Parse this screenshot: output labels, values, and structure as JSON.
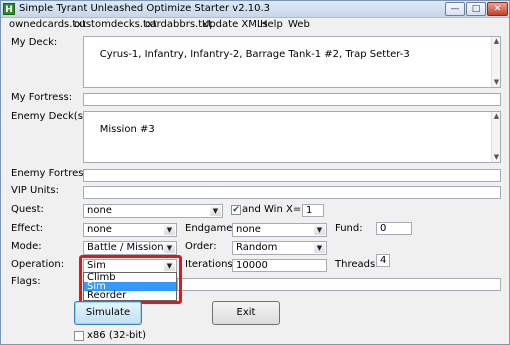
{
  "window": {
    "title": "Simple Tyrant Unleashed Optimize Starter v2.10.3",
    "icon": "H"
  },
  "menu": [
    "ownedcards.txt",
    "customdecks.txt",
    "cardabbrs.txt",
    "Update XMLs",
    "Help",
    "Web"
  ],
  "fields": {
    "my_deck": {
      "label": "My Deck:",
      "value": "Cyrus-1, Infantry, Infantry-2, Barrage Tank-1 #2, Trap Setter-3"
    },
    "my_fortress": {
      "label": "My Fortress:",
      "value": ""
    },
    "enemy_decks": {
      "label": "Enemy Deck(s):",
      "value": "Mission #3"
    },
    "enemy_fortress": {
      "label": "Enemy Fortress:",
      "value": ""
    },
    "vip_units": {
      "label": "VIP Units:",
      "value": ""
    },
    "quest": {
      "label": "Quest:",
      "value": "none"
    },
    "and_win": {
      "label": "and Win",
      "checked": true
    },
    "x_eq": {
      "label": "X=",
      "value": "1"
    },
    "effect": {
      "label": "Effect:",
      "value": "none"
    },
    "endgame": {
      "label": "Endgame:",
      "value": "none"
    },
    "fund": {
      "label": "Fund:",
      "value": "0"
    },
    "mode": {
      "label": "Mode:",
      "value": "Battle / Mission"
    },
    "order": {
      "label": "Order:",
      "value": "Random"
    },
    "operation": {
      "label": "Operation:",
      "value": "Sim",
      "options": [
        "Climb",
        "Sim",
        "Reorder"
      ],
      "selected_option": "Sim"
    },
    "iterations": {
      "label": "Iterations:",
      "value": "10000"
    },
    "threads": {
      "label": "Threads:",
      "value": "4"
    },
    "flags": {
      "label": "Flags:",
      "value": ""
    },
    "x86": {
      "label": "x86 (32-bit)",
      "checked": false
    }
  },
  "buttons": {
    "simulate": "Simulate",
    "exit": "Exit"
  },
  "titlebar_buttons": {
    "minimize": "—",
    "maximize": "□",
    "close": "✕"
  },
  "colors": {
    "highlight": "#e01818",
    "selection": "#3399ff"
  }
}
